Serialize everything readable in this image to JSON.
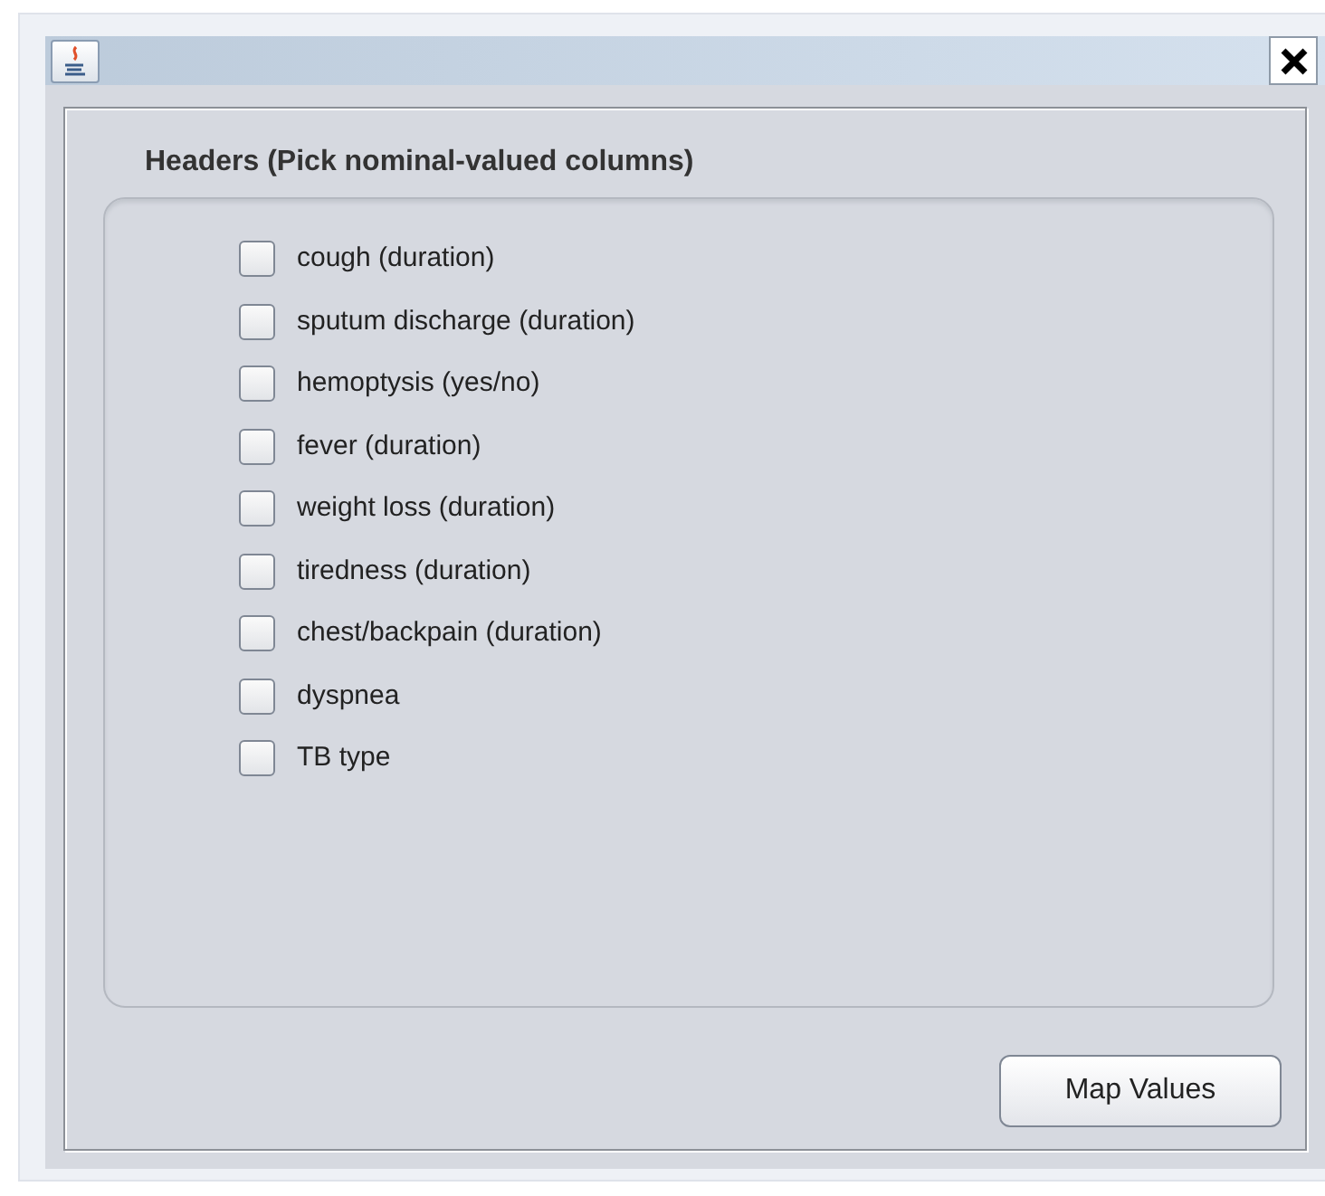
{
  "panel": {
    "title": "Headers (Pick nominal-valued columns)",
    "columns": [
      {
        "label": "cough (duration)",
        "checked": false
      },
      {
        "label": "sputum discharge (duration)",
        "checked": false
      },
      {
        "label": "hemoptysis (yes/no)",
        "checked": false
      },
      {
        "label": "fever (duration)",
        "checked": false
      },
      {
        "label": "weight loss (duration)",
        "checked": false
      },
      {
        "label": "tiredness (duration)",
        "checked": false
      },
      {
        "label": "chest/backpain (duration)",
        "checked": false
      },
      {
        "label": "dyspnea",
        "checked": false
      },
      {
        "label": "TB type",
        "checked": false
      }
    ]
  },
  "buttons": [
    {
      "label": "Map Values"
    }
  ]
}
